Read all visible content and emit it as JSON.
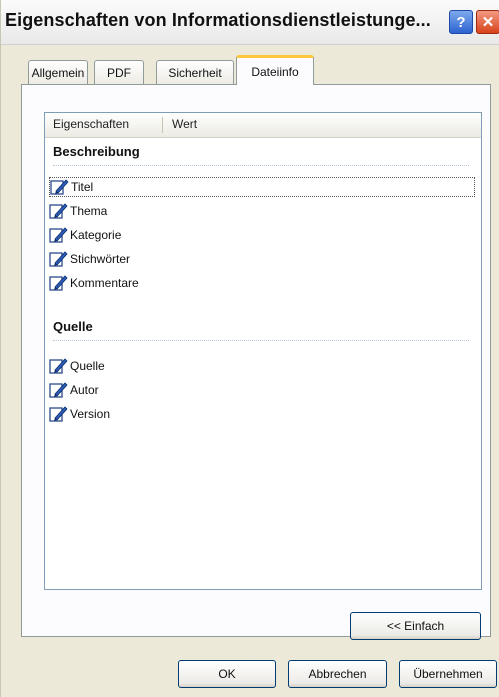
{
  "window": {
    "title": "Eigenschaften von Informationsdienstleistunge...",
    "help_label": "?",
    "close_label": "✕"
  },
  "tabs": [
    {
      "label": "Allgemein",
      "active": false
    },
    {
      "label": "PDF",
      "active": false
    },
    {
      "label": "Sicherheit",
      "active": false
    },
    {
      "label": "Dateiinfo",
      "active": true
    }
  ],
  "list": {
    "columns": [
      "Eigenschaften",
      "Wert"
    ],
    "groups": [
      {
        "heading": "Beschreibung",
        "items": [
          "Titel",
          "Thema",
          "Kategorie",
          "Stichwörter",
          "Kommentare"
        ]
      },
      {
        "heading": "Quelle",
        "items": [
          "Quelle",
          "Autor",
          "Version"
        ]
      }
    ]
  },
  "buttons": {
    "simple": "<< Einfach",
    "ok": "OK",
    "cancel": "Abbrechen",
    "apply": "Übernehmen"
  },
  "icons": {
    "row_icon": "edit-property-icon"
  }
}
